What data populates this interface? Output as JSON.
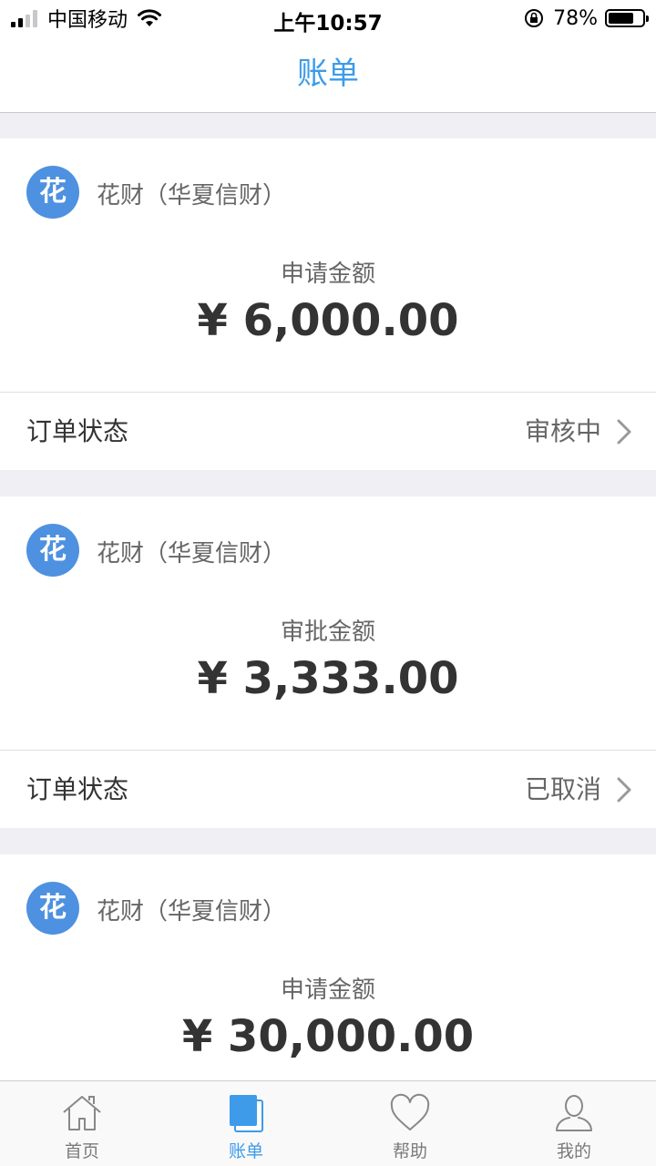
{
  "status_bar": {
    "carrier": "中国移动",
    "time": "上午10:57",
    "battery": "78%",
    "battery_level": 0.78
  },
  "nav": {
    "title": "账单"
  },
  "cards": [
    {
      "logo_char": "花",
      "lender": "花财（华夏信财）",
      "amount_label": "申请金额",
      "amount": "¥ 6,000.00",
      "status_label": "订单状态",
      "status_value": "审核中"
    },
    {
      "logo_char": "花",
      "lender": "花财（华夏信财）",
      "amount_label": "审批金额",
      "amount": "¥ 3,333.00",
      "status_label": "订单状态",
      "status_value": "已取消"
    },
    {
      "logo_char": "花",
      "lender": "花财（华夏信财）",
      "amount_label": "申请金额",
      "amount": "¥ 30,000.00"
    }
  ],
  "tabs": [
    {
      "label": "首页",
      "icon": "home-icon",
      "active": false
    },
    {
      "label": "账单",
      "icon": "bill-icon",
      "active": true
    },
    {
      "label": "帮助",
      "icon": "heart-icon",
      "active": false
    },
    {
      "label": "我的",
      "icon": "person-icon",
      "active": false
    }
  ],
  "colors": {
    "accent": "#3d9be9",
    "logo": "#4e91e0",
    "background": "#efeff4"
  }
}
